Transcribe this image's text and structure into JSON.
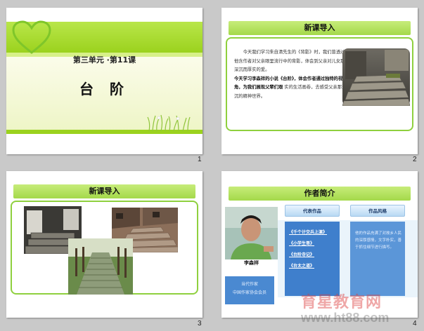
{
  "slides": [
    {
      "number": "1",
      "subtitle": "第三单元  ·第11课",
      "title": "台 阶",
      "icons": [
        "heart-outline-icon",
        "grass-decoration"
      ]
    },
    {
      "number": "2",
      "header": "新课导入",
      "paragraph_1": "　　今天我们学习朱自清先生的《背影》时，我们曾透过他含作者对父亲眼里流行中的背影，体会到父亲对儿女那深沉而厚实的爱。",
      "paragraph_bold": "今天学习李森祥的小说《台阶》，体会作者通过独特的视角，为我们展现父辈们艰",
      "paragraph_2": "实的生活画卷，去感受父亲那深沉的精神世界。",
      "photo": "stone-steps-photo"
    },
    {
      "number": "3",
      "header": "新课导入",
      "photos": [
        "stone-step-closeup-photo",
        "village-steps-photo",
        "stone-path-photo"
      ]
    },
    {
      "number": "4",
      "header": "作者简介",
      "author_name": "李森祥",
      "bio_line_1": "当代作家",
      "bio_line_2": "中国作家协会会员",
      "col1_header": "代表作品",
      "col2_header": "作品风格",
      "works": [
        "《千个计交兵上演》",
        "《小学生哥》",
        "《台阶寺记》",
        "《台太之道》"
      ],
      "style_text": "他的作品充满了对故乡人民的深厚感情，文字朴实，善于抓住细节进行描写。"
    }
  ],
  "watermark": {
    "line1": "育星教育网",
    "line2": "www.ht88.com"
  },
  "colors": {
    "green_bar": "#9bd21e",
    "blue_column": "#3f7fcc",
    "background": "#c9c9c9"
  }
}
